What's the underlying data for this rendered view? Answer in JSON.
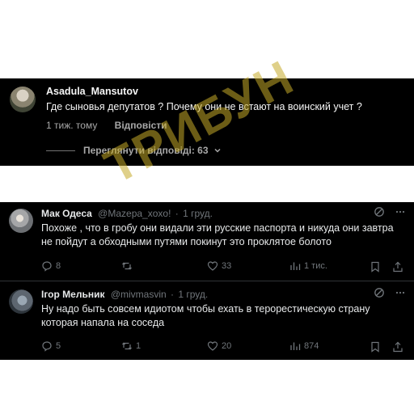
{
  "instagram_comment": {
    "username": "Asadula_Mansutov",
    "text": "Где сыновья депутатов ? Почему они не встают на воинский учет ?",
    "time": "1 тиж. тому",
    "reply_label": "Відповісти",
    "view_replies": "Переглянути відповіді: 63"
  },
  "tweets": [
    {
      "name": "Мак Одеса",
      "handle": "@Mazepa_xoxo!",
      "dot": "·",
      "time": "1 груд.",
      "text": "Похоже , что в гробу они видали эти русские паспорта и никуда они завтра не пойдут а обходными путями покинут это проклятое болото",
      "replies": "8",
      "retweets": "",
      "likes": "33",
      "views": "1 тис."
    },
    {
      "name": "Ігор Мельник",
      "handle": "@mivmasvin",
      "dot": "·",
      "time": "1 груд.",
      "text": "Ну надо быть совсем идиотом чтобы ехать в терорестическую страну которая напала на соседа",
      "replies": "5",
      "retweets": "1",
      "likes": "20",
      "views": "874"
    }
  ],
  "watermark": "ТРИБУН",
  "colors": {
    "background": "#000000",
    "text": "#e7e9ea",
    "muted": "#71767b",
    "watermark": "#c4aa28"
  }
}
